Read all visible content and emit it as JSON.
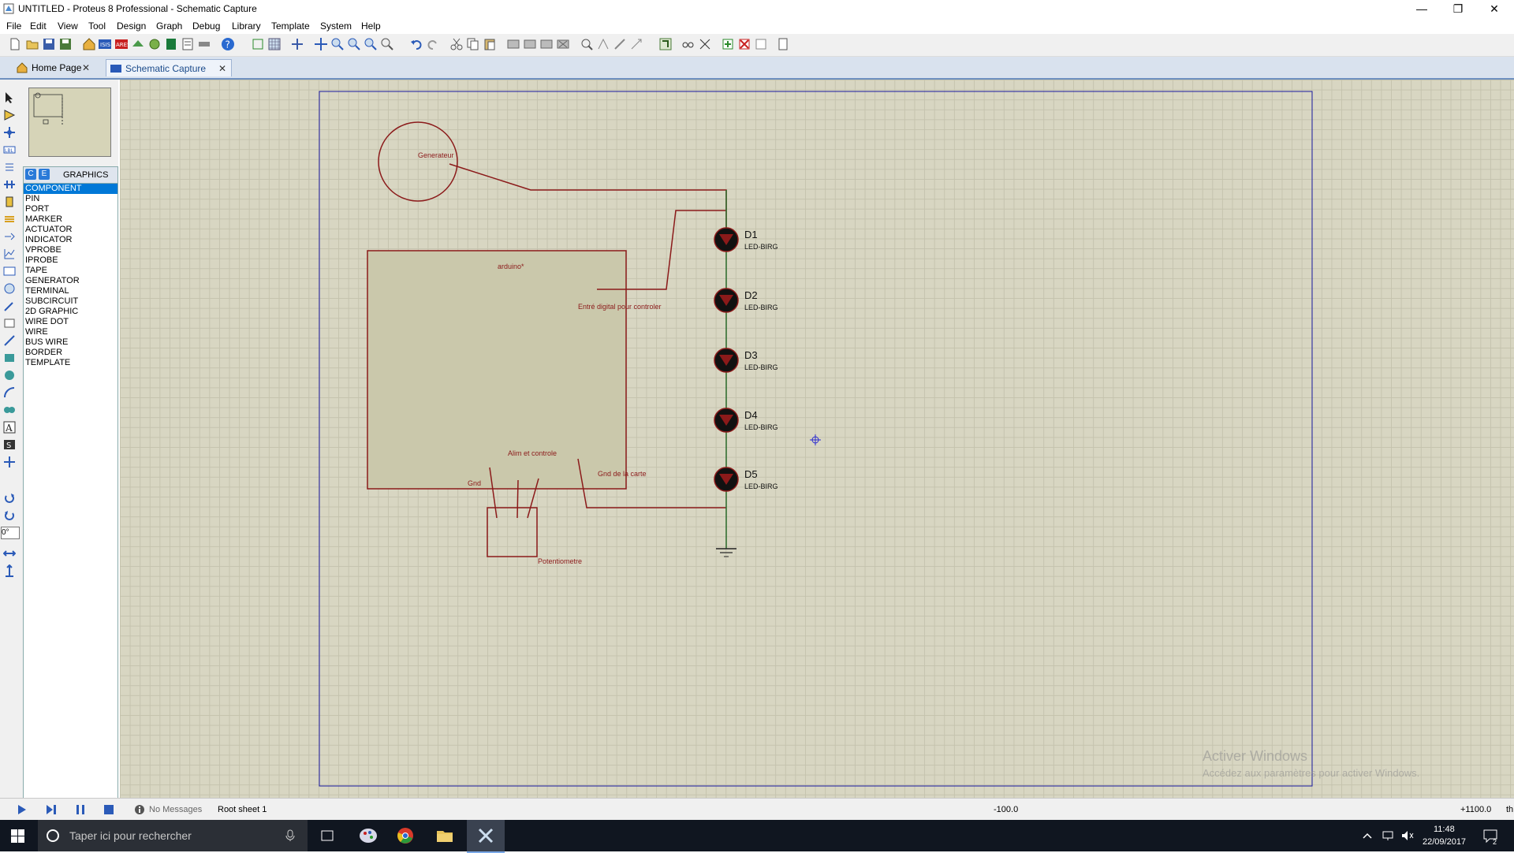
{
  "window": {
    "title": "UNTITLED - Proteus 8 Professional - Schematic Capture",
    "controls": {
      "minimize": "—",
      "restore": "❐",
      "close": "✕"
    }
  },
  "menu": [
    "File",
    "Edit",
    "View",
    "Tool",
    "Design",
    "Graph",
    "Debug",
    "Library",
    "Template",
    "System",
    "Help"
  ],
  "tabs": [
    {
      "label": "Home Page",
      "close": "✕"
    },
    {
      "label": "Schematic Capture",
      "close": "✕"
    }
  ],
  "sidebar": {
    "rotation_value": "0°",
    "mode_buttons": [
      "C",
      "E"
    ],
    "list_header": "GRAPHICS",
    "items": [
      "COMPONENT",
      "PIN",
      "PORT",
      "MARKER",
      "ACTUATOR",
      "INDICATOR",
      "VPROBE",
      "IPROBE",
      "TAPE",
      "GENERATOR",
      "TERMINAL",
      "SUBCIRCUIT",
      "2D GRAPHIC",
      "WIRE DOT",
      "WIRE",
      "BUS WIRE",
      "BORDER",
      "TEMPLATE"
    ],
    "selected_index": 0
  },
  "schematic": {
    "generator_label": "Generateur",
    "arduino_label": "arduino*",
    "digital_in_label": "Entré digital pour controler",
    "power_control_label": "Alim et controle",
    "gnd_label": "Gnd",
    "board_gnd_label": "Gnd de la carte",
    "pot_label": "Potentiometre",
    "leds": [
      {
        "ref": "D1",
        "value": "LED-BIRG"
      },
      {
        "ref": "D2",
        "value": "LED-BIRG"
      },
      {
        "ref": "D3",
        "value": "LED-BIRG"
      },
      {
        "ref": "D4",
        "value": "LED-BIRG"
      },
      {
        "ref": "D5",
        "value": "LED-BIRG"
      }
    ],
    "colors": {
      "wire": "#8b1a1a",
      "sheet": "#1a1aa0",
      "grid": "#d8d6c2"
    }
  },
  "watermark": {
    "line1": "Activer Windows",
    "line2": "Accédez aux paramètres pour activer Windows."
  },
  "status": {
    "messages": "No Messages",
    "sheet": "Root sheet 1",
    "coord_x": "-100.0",
    "coord_y": "+1100.0",
    "unit": "th"
  },
  "taskbar": {
    "search_placeholder": "Taper ici pour rechercher",
    "time": "11:48",
    "date": "22/09/2017",
    "notifications": "2"
  }
}
